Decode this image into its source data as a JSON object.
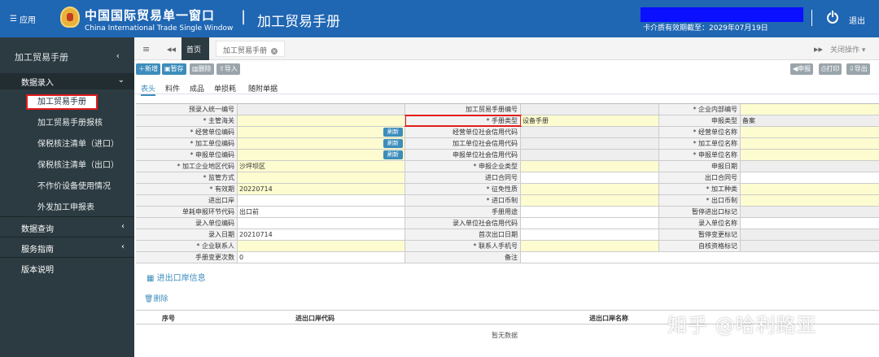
{
  "header": {
    "app_menu": "应用",
    "brand_cn": "中国国际贸易单一窗口",
    "brand_en": "China International Trade Single Window",
    "page_title": "加工贸易手册",
    "validity": "卡介质有效期截至：2029年07月19日",
    "logout": "退出"
  },
  "sidebar": {
    "title": "加工贸易手册",
    "group_entry": "数据录入",
    "items": [
      "加工贸易手册",
      "加工贸易手册报核",
      "保税核注清单（进口）",
      "保税核注清单（出口）",
      "不作价设备使用情况",
      "外发加工申报表"
    ],
    "group_query": "数据查询",
    "group_guide": "服务指南",
    "group_version": "版本说明"
  },
  "tabs": {
    "home": "首页",
    "active": "加工贸易手册",
    "close_ops": "关闭操作"
  },
  "toolbar": {
    "add": "新增",
    "save": "暂存",
    "delete": "删除",
    "import": "导入",
    "declare": "申报",
    "print": "打印",
    "export": "导出"
  },
  "subtabs": [
    "表头",
    "料件",
    "成品",
    "单损耗",
    "随附单据"
  ],
  "form": {
    "r1": [
      "预录入统一编号",
      "",
      "加工贸易手册编号",
      "",
      "* 企业内部编号",
      ""
    ],
    "r2": [
      "* 主管海关",
      "",
      "* 手册类型",
      "设备手册",
      "申报类型",
      "备案"
    ],
    "r3": [
      "* 经营单位编码",
      "",
      "经营单位社会信用代码",
      "",
      "* 经营单位名称",
      ""
    ],
    "r4": [
      "* 加工单位编码",
      "",
      "加工单位社会信用代码",
      "",
      "* 加工单位名称",
      ""
    ],
    "r5": [
      "* 申报单位编码",
      "",
      "申报单位社会信用代码",
      "",
      "* 申报单位名称",
      ""
    ],
    "r6": [
      "* 加工企业地区代码",
      "沙坪坝区",
      "* 申报企业类型",
      "",
      "申报日期",
      ""
    ],
    "r7": [
      "* 监管方式",
      "",
      "进口合同号",
      "",
      "出口合同号",
      ""
    ],
    "r8": [
      "* 有效期",
      "20220714",
      "* 征免性质",
      "",
      "* 加工种类",
      ""
    ],
    "r9": [
      "进出口岸",
      "",
      "* 进口币制",
      "",
      "* 出口币制",
      ""
    ],
    "r10": [
      "单耗申报环节代码",
      "出口前",
      "手册用途",
      "",
      "暂停进出口标记",
      ""
    ],
    "r11": [
      "录入单位编码",
      "",
      "录入单位社会信用代码",
      "",
      "录入单位名称",
      ""
    ],
    "r12": [
      "录入日期",
      "20210714",
      "首次出口日期",
      "",
      "暂停变更标记",
      ""
    ],
    "r13": [
      "* 企业联系人",
      "",
      "* 联系人手机号",
      "",
      "自核资格标记",
      ""
    ],
    "r14": [
      "手册变更次数",
      "0",
      "备注",
      "",
      "",
      ""
    ],
    "refresh": "刷新"
  },
  "ports": {
    "title": "进出口岸信息",
    "delete": "删除",
    "col_no": "序号",
    "col_code": "进出口岸代码",
    "col_name": "进出口岸名称",
    "empty": "暂无数据"
  },
  "watermark": "知乎 @哈利路亚"
}
